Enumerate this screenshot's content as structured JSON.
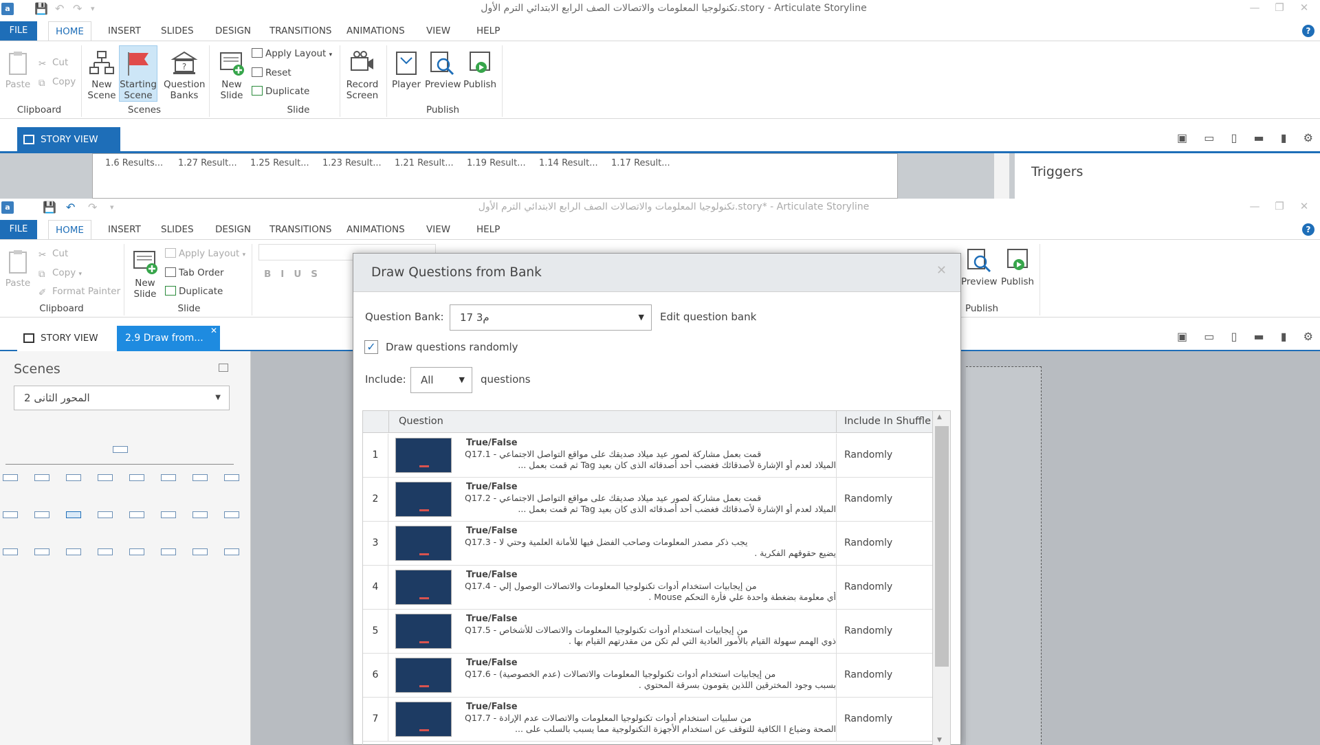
{
  "back_window": {
    "title": "تكنولوجيا المعلومات والاتصالات الصف الرابع الابتدائي الترم الأول.story -  Articulate Storyline",
    "menu": {
      "file": "FILE",
      "items": [
        "HOME",
        "INSERT",
        "SLIDES",
        "DESIGN",
        "TRANSITIONS",
        "ANIMATIONS",
        "VIEW",
        "HELP"
      ]
    },
    "ribbon": {
      "paste": "Paste",
      "cut": "Cut",
      "copy": "Copy",
      "clipboard": "Clipboard",
      "new_scene": "New Scene",
      "starting_scene": "Starting Scene",
      "question_banks": "Question Banks",
      "scenes": "Scenes",
      "new_slide": "New Slide",
      "apply_layout": "Apply Layout",
      "reset": "Reset",
      "duplicate": "Duplicate",
      "slide": "Slide",
      "record_screen": "Record Screen",
      "player": "Player",
      "preview": "Preview",
      "publish": "Publish",
      "publish_group": "Publish"
    },
    "tab_story_view": "STORY VIEW",
    "results": [
      "1.6 Results...",
      "1.27 Result...",
      "1.25 Result...",
      "1.23 Result...",
      "1.21 Result...",
      "1.19 Result...",
      "1.14 Result...",
      "1.17 Result..."
    ],
    "triggers_title": "Triggers"
  },
  "front_window": {
    "title": "تكنولوجيا المعلومات والاتصالات الصف الرابع الابتدائي الترم الأول.story* -  Articulate Storyline",
    "menu": {
      "file": "FILE",
      "items": [
        "HOME",
        "INSERT",
        "SLIDES",
        "DESIGN",
        "TRANSITIONS",
        "ANIMATIONS",
        "VIEW",
        "HELP"
      ]
    },
    "ribbon": {
      "paste": "Paste",
      "cut": "Cut",
      "copy": "Copy",
      "format_painter": "Format Painter",
      "clipboard": "Clipboard",
      "new_slide": "New Slide",
      "apply_layout": "Apply Layout",
      "tab_order": "Tab Order",
      "duplicate": "Duplicate",
      "slide": "Slide",
      "preview": "Preview",
      "publish": "Publish",
      "publish_group": "Publish"
    },
    "tabs": {
      "story_view": "STORY VIEW",
      "draw": "2.9 Draw from..."
    },
    "scenes": {
      "title": "Scenes",
      "selected": "المحور الثانى 2"
    }
  },
  "dialog": {
    "title": "Draw Questions from Bank",
    "question_bank_label": "Question Bank:",
    "question_bank_value": "م3 17",
    "edit_link": "Edit question bank",
    "draw_randomly": "Draw questions randomly",
    "draw_randomly_checked": true,
    "include_label": "Include:",
    "include_value": "All",
    "questions_suffix": "questions",
    "columns": {
      "question": "Question",
      "shuffle": "Include In Shuffle"
    },
    "rows": [
      {
        "num": "1",
        "type": "True/False",
        "line1": "Q17.1 - قمت بعمل مشاركة لصور عيد ميلاد صديقك على مواقع التواصل الاجتماعي",
        "line2": "الميلاد لعدم  أو الإشارة لأصدقائك فغضب أحد أصدقائه الذى كان بعيد Tag ثم قمت بعمل ...",
        "shuffle": "Randomly"
      },
      {
        "num": "2",
        "type": "True/False",
        "line1": "Q17.2 - قمت بعمل مشاركة لصور عيد ميلاد صديقك على مواقع التواصل الاجتماعي",
        "line2": "الميلاد لعدم  أو الإشارة لأصدقائك فغضب أحد أصدقائه الذى كان بعيد Tag ثم قمت بعمل ...",
        "shuffle": "Randomly"
      },
      {
        "num": "3",
        "type": "True/False",
        "line1": "Q17.3 - يجب ذكر مصدر المعلومات وصاحب الفضل فيها للأمانة العلمية وحتي لا",
        "line2": "يضيع حقوقهم الفكرية .",
        "shuffle": "Randomly"
      },
      {
        "num": "4",
        "type": "True/False",
        "line1": "Q17.4 - من إيجابيات استخدام أدوات تكنولوجيا المعلومات والاتصالات الوصول إلي",
        "line2": "أي معلومة بضغطة واحدة علي فأرة التحكم Mouse .",
        "shuffle": "Randomly"
      },
      {
        "num": "5",
        "type": "True/False",
        "line1": "Q17.5 - من إيجابيات استخدام أدوات تكنولوجيا المعلومات والاتصالات للأشخاص",
        "line2": "ذوي الهمم سهولة القيام بالأمور العادية التي لم تكن من مقدرتهم القيام بها .",
        "shuffle": "Randomly"
      },
      {
        "num": "6",
        "type": "True/False",
        "line1": "Q17.6 - من إيجابيات استخدام أدوات تكنولوجيا المعلومات والاتصالات (عدم الخصوصية)",
        "line2": "بسبب وجود المخترقين اللذين يقومون بسرقة المحتوي .",
        "shuffle": "Randomly"
      },
      {
        "num": "7",
        "type": "True/False",
        "line1": "Q17.7 - من سلبيات استخدام أدوات تكنولوجيا المعلومات والاتصالات عدم الإرادة",
        "line2": "الصحة وضياع ا    الكافية للتوقف عن استخدام الأجهزة التكنولوجية مما يسبب بالسلب على ...",
        "shuffle": "Randomly"
      }
    ]
  },
  "colors": {
    "accent": "#1e6eb8",
    "tab_active": "#1e8be0",
    "thumb": "#1d3b63",
    "canvas": "#b8bcc1"
  }
}
